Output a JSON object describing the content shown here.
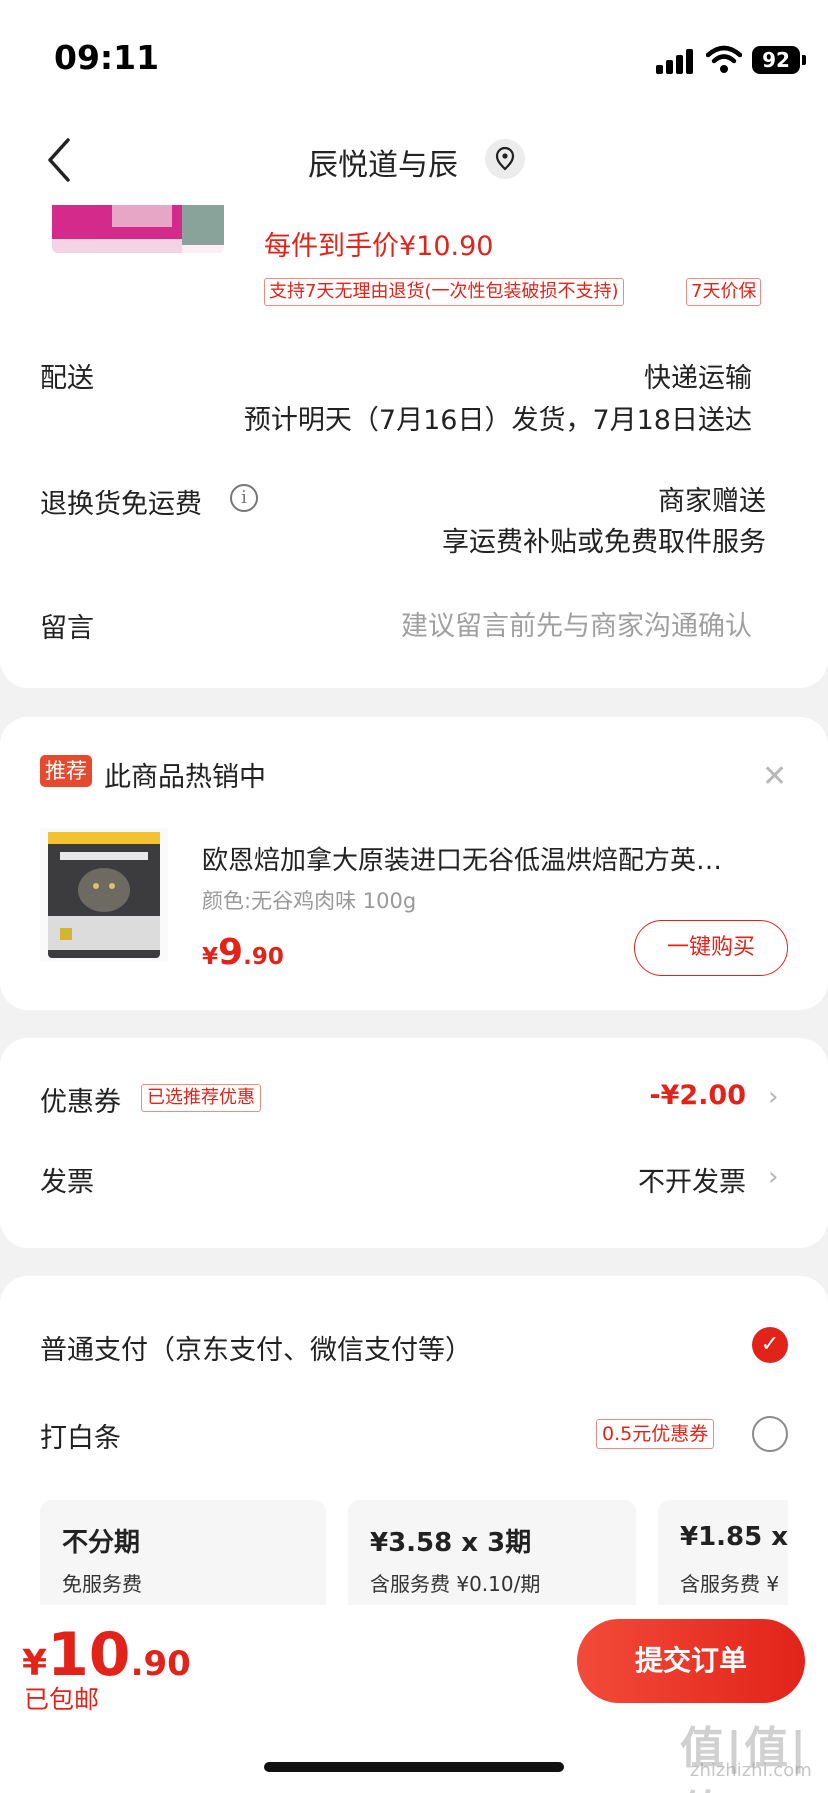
{
  "status": {
    "time": "09:11",
    "battery": "92"
  },
  "nav": {
    "title": "辰悦道与辰"
  },
  "order_item": {
    "unit_price_text": "每件到手价¥10.90",
    "tags": [
      "支持7天无理由退货(一次性包装破损不支持)",
      "7天价保"
    ]
  },
  "delivery": {
    "label": "配送",
    "method": "快递运输",
    "schedule": "预计明天（7月16日）发货，7月18日送达"
  },
  "return_shipping": {
    "label": "退换货免运费",
    "value": "商家赠送",
    "desc": "享运费补贴或免费取件服务"
  },
  "message": {
    "label": "留言",
    "placeholder": "建议留言前先与商家沟通确认"
  },
  "recommend": {
    "badge": "推荐",
    "title": "此商品热销中",
    "product_name": "欧恩焙加拿大原装进口无谷低温烘焙配方英…",
    "spec": "颜色:无谷鸡肉味 100g",
    "price_currency": "¥",
    "price_int": "9",
    "price_dec": ".90",
    "buy_label": "一键购买"
  },
  "coupon": {
    "label": "优惠券",
    "tag": "已选推荐优惠",
    "value": "-¥2.00"
  },
  "invoice": {
    "label": "发票",
    "value": "不开发票"
  },
  "payment": {
    "normal_label": "普通支付（京东支付、微信支付等）",
    "normal_selected": true,
    "baitiao_label": "打白条",
    "baitiao_tag": "0.5元优惠券",
    "baitiao_selected": false,
    "plans": [
      {
        "title": "不分期",
        "fee": "免服务费"
      },
      {
        "title": "¥3.58 x 3期",
        "fee": "含服务费 ¥0.10/期"
      },
      {
        "title": "¥1.85 x",
        "fee": "含服务费 ¥"
      }
    ]
  },
  "footer": {
    "total_currency": "¥",
    "total_int": "10",
    "total_dec": ".90",
    "shipping": "已包邮",
    "submit_label": "提交订单"
  },
  "watermark": {
    "main": "值|值|值",
    "sub": "zhizhizhi.com"
  },
  "colors": {
    "accent": "#e2231a",
    "background": "#f2f2f2"
  }
}
